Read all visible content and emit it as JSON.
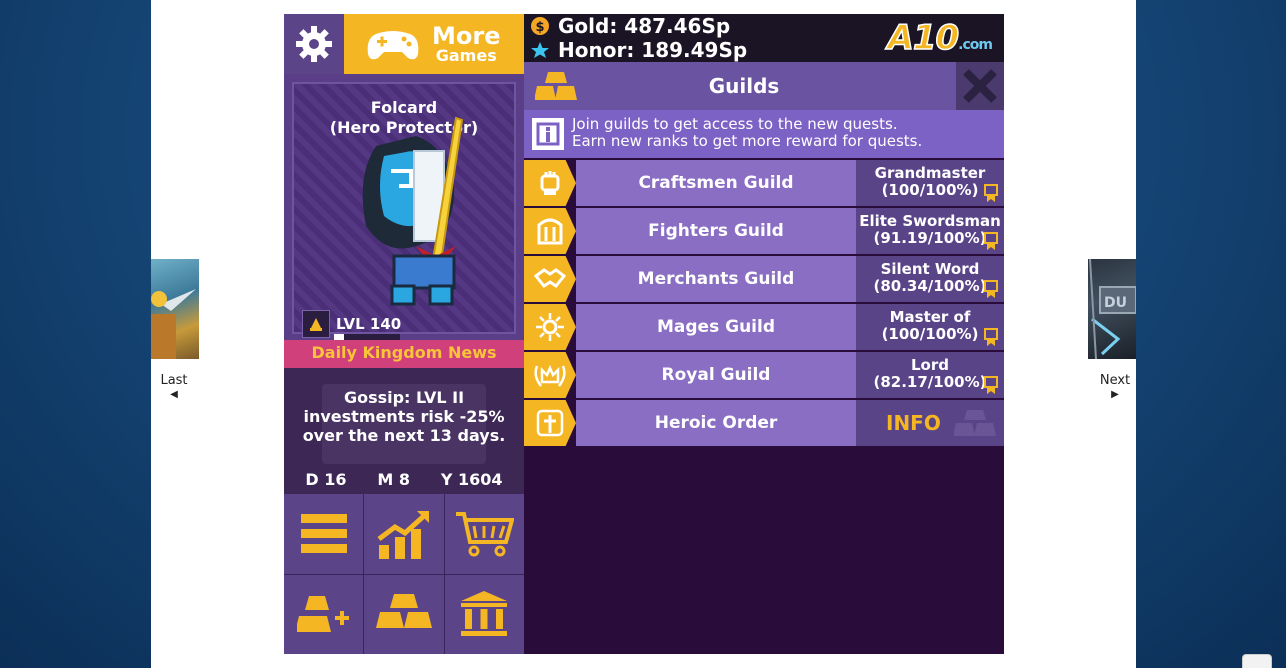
{
  "nav": {
    "last_label": "Last",
    "next_label": "Next",
    "last_arrow": "◀",
    "next_arrow": "▶"
  },
  "top_left": {
    "more_games_line1": "More",
    "more_games_line2": "Games"
  },
  "resources": {
    "gold": "Gold: 487.46Sp",
    "honor": "Honor: 189.49Sp",
    "brand": "A10",
    "brand_suffix": ".com"
  },
  "hero": {
    "name": "Folcard",
    "title": "(Hero Protector)",
    "level": "LVL 140",
    "level_progress": 0.15
  },
  "news": {
    "title": "Daily Kingdom News",
    "text_line1": "Gossip: LVL II",
    "text_line2": "investments risk -25%",
    "text_line3": "over the next 13 days.",
    "day": "D 16",
    "month": "M 8",
    "year": "Y 1604"
  },
  "guilds_panel": {
    "title": "Guilds",
    "info_line1": "Join guilds to get access to the new quests.",
    "info_line2": "Earn new ranks to get more reward for quests.",
    "rows": [
      {
        "name": "Craftsmen Guild",
        "rank": "Grandmaster",
        "progress": "(100/100%)"
      },
      {
        "name": "Fighters Guild",
        "rank": "Elite Swordsman",
        "progress": "(91.19/100%)"
      },
      {
        "name": "Merchants Guild",
        "rank": "Silent Word",
        "progress": "(80.34/100%)"
      },
      {
        "name": "Mages Guild",
        "rank": "Master of",
        "progress": "(100/100%)"
      },
      {
        "name": "Royal Guild",
        "rank": "Lord",
        "progress": "(82.17/100%)"
      },
      {
        "name": "Heroic Order",
        "info_label": "INFO"
      }
    ]
  },
  "colors": {
    "accent_gold": "#f5b623",
    "panel_purple": "#8a6ec4",
    "dark_purple": "#2a0c3a",
    "news_pink": "#d0407a"
  }
}
